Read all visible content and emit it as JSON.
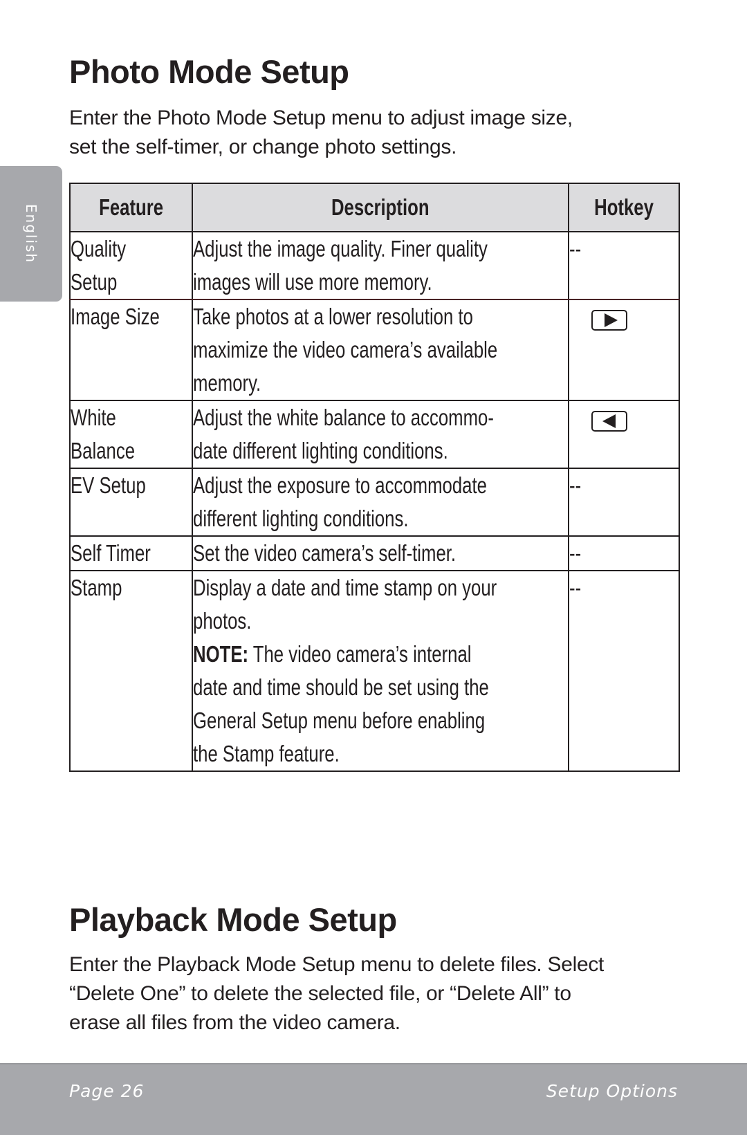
{
  "language_tab": "English",
  "sections": [
    {
      "title": "Photo Mode Setup",
      "intro_lines": [
        "Enter the Photo Mode Setup menu to adjust image size,",
        "set the self-timer, or change photo settings."
      ]
    },
    {
      "title": "Playback Mode Setup",
      "intro_lines": [
        "Enter the Playback Mode Setup menu to delete files. Select",
        "“Delete One” to delete the selected file, or “Delete All” to",
        "erase all files from the video camera."
      ]
    }
  ],
  "table": {
    "headers": [
      "Feature",
      "Description",
      "Hotkey"
    ],
    "rows": [
      {
        "feature": [
          "Quality",
          "Setup"
        ],
        "description": [
          "Adjust the image quality. Finer quality",
          "images will use more memory."
        ],
        "hotkey": "--",
        "hotkey_icon": null
      },
      {
        "feature": [
          "Image Size"
        ],
        "description": [
          "Take photos at a lower resolution to",
          "maximize the video camera’s available",
          "memory."
        ],
        "hotkey": "",
        "hotkey_icon": "right-arrow-key-icon"
      },
      {
        "feature": [
          "White",
          "Balance"
        ],
        "description": [
          "Adjust the white balance to accommo-",
          "date different lighting conditions."
        ],
        "hotkey": "",
        "hotkey_icon": "left-arrow-key-icon"
      },
      {
        "feature": [
          "EV Setup"
        ],
        "description": [
          "Adjust the exposure to accommodate",
          "different lighting conditions."
        ],
        "hotkey": "--",
        "hotkey_icon": null
      },
      {
        "feature": [
          "Self Timer"
        ],
        "description": [
          "Set the video camera’s self-timer."
        ],
        "hotkey": "--",
        "hotkey_icon": null
      },
      {
        "feature": [
          "Stamp"
        ],
        "description": [
          "Display a date and time stamp on your",
          "photos."
        ],
        "note_label": "NOTE:",
        "note_lines": [
          " The video camera’s internal",
          "date and time should be set using the",
          "General Setup menu before enabling",
          "the Stamp feature."
        ],
        "hotkey": "--",
        "hotkey_icon": null
      }
    ]
  },
  "footer": {
    "page": "Page 26",
    "section": "Setup Options"
  },
  "colors": {
    "tab_gray": "#a7a8ac",
    "header_fill": "#dcdcde",
    "text": "#231f20"
  }
}
